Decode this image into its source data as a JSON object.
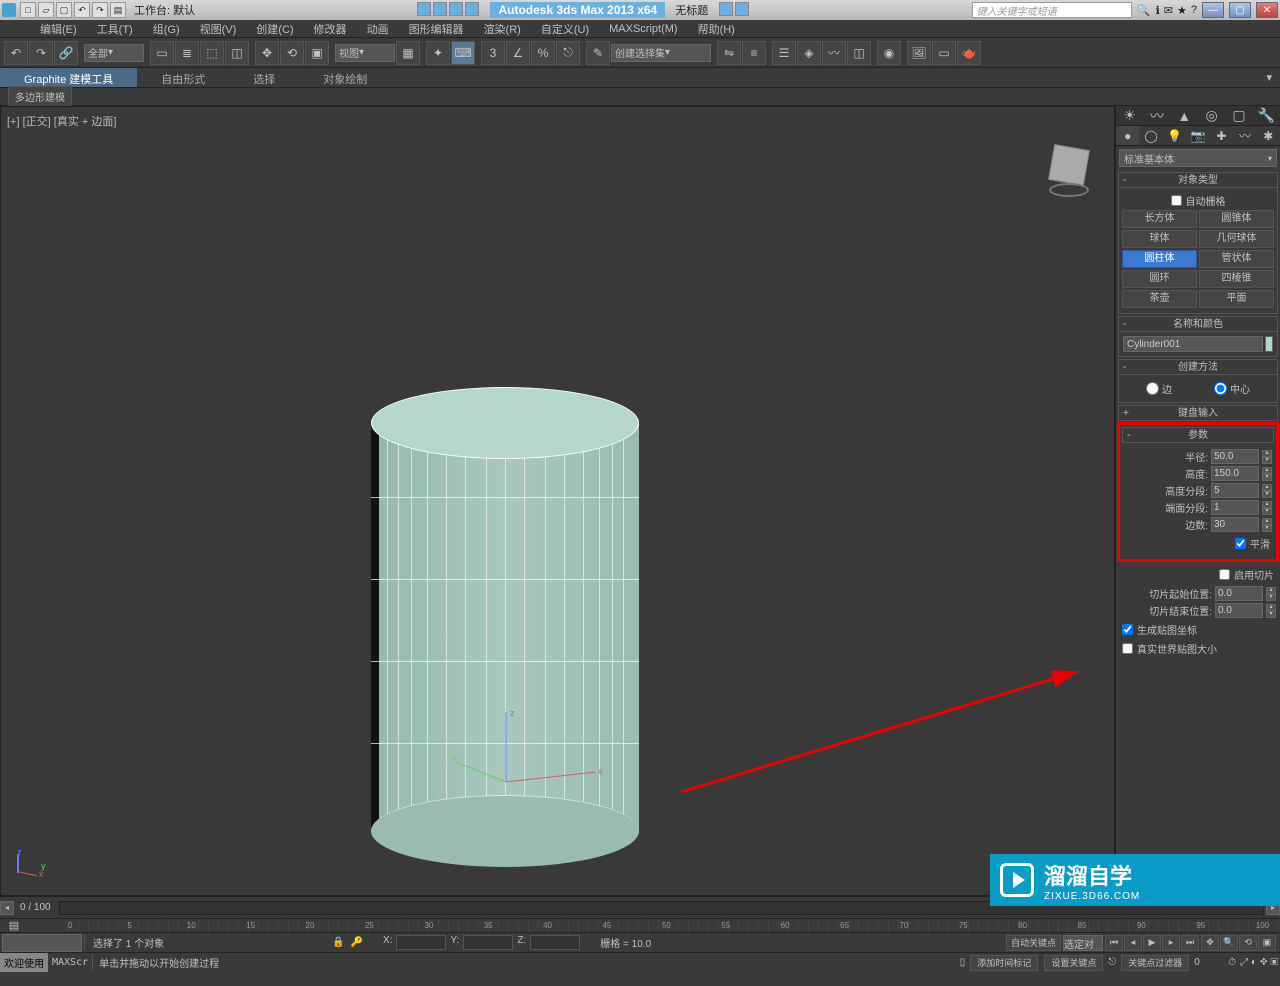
{
  "titlebar": {
    "workspace": "工作台: 默认",
    "app_title": "Autodesk 3ds Max  2013 x64",
    "doc_title": "无标题",
    "search_placeholder": "键入关键字或短语"
  },
  "menubar": [
    "编辑(E)",
    "工具(T)",
    "组(G)",
    "视图(V)",
    "创建(C)",
    "修改器",
    "动画",
    "图形编辑器",
    "渲染(R)",
    "自定义(U)",
    "MAXScript(M)",
    "帮助(H)"
  ],
  "toolbar": {
    "filter_dd": "全部",
    "view_dd": "视图",
    "selset_dd": "创建选择集"
  },
  "ribbon": {
    "tabs": [
      "Graphite 建模工具",
      "自由形式",
      "选择",
      "对象绘制"
    ],
    "bar_label": "多边形建模"
  },
  "viewport": {
    "label": "[+] [正交] [真实 + 边面]"
  },
  "cmdpanel": {
    "category_dd": "标准基本体",
    "objtype_head": "对象类型",
    "autogrid": "自动栅格",
    "primitives": [
      [
        "长方体",
        "圆锥体"
      ],
      [
        "球体",
        "几何球体"
      ],
      [
        "圆柱体",
        "管状体"
      ],
      [
        "圆环",
        "四棱锥"
      ],
      [
        "茶壶",
        "平面"
      ]
    ],
    "namecolor_head": "名称和颜色",
    "obj_name": "Cylinder001",
    "create_head": "创建方法",
    "radio_edge": "边",
    "radio_center": "中心",
    "keyboard_head": "键盘输入",
    "params_head": "参数",
    "params": {
      "radius_lbl": "半径:",
      "radius": "50.0",
      "height_lbl": "高度:",
      "height": "150.0",
      "hseg_lbl": "高度分段:",
      "hseg": "5",
      "cseg_lbl": "端面分段:",
      "cseg": "1",
      "sides_lbl": "边数:",
      "sides": "30",
      "smooth": "平滑",
      "slice_on": "启用切片",
      "slice_from_lbl": "切片起始位置:",
      "slice_from": "0.0",
      "slice_to_lbl": "切片结束位置:",
      "slice_to": "0.0",
      "genmap": "生成贴图坐标",
      "realworld": "真实世界贴图大小"
    }
  },
  "timeline": {
    "frames": "0 / 100",
    "ticks": [
      "0",
      "5",
      "10",
      "15",
      "20",
      "25",
      "30",
      "35",
      "40",
      "45",
      "50",
      "55",
      "60",
      "65",
      "70",
      "75",
      "80",
      "85",
      "90",
      "95",
      "100"
    ]
  },
  "status": {
    "selected": "选择了 1 个对象",
    "x": "X:",
    "y": "Y:",
    "z": "Z:",
    "grid": "栅格 = 10.0",
    "autokey": "自动关键点",
    "sel_set": "选定对",
    "setkey": "设置关键点",
    "keyfilter": "关键点过滤器",
    "add_marker": "添加时间标记"
  },
  "status2": {
    "welcome": "欢迎使用",
    "script": "MAXScr",
    "prompt": "单击并拖动以开始创建过程"
  },
  "watermark": {
    "text": "溜溜自学",
    "url": "ZIXUE.3D66.COM"
  }
}
